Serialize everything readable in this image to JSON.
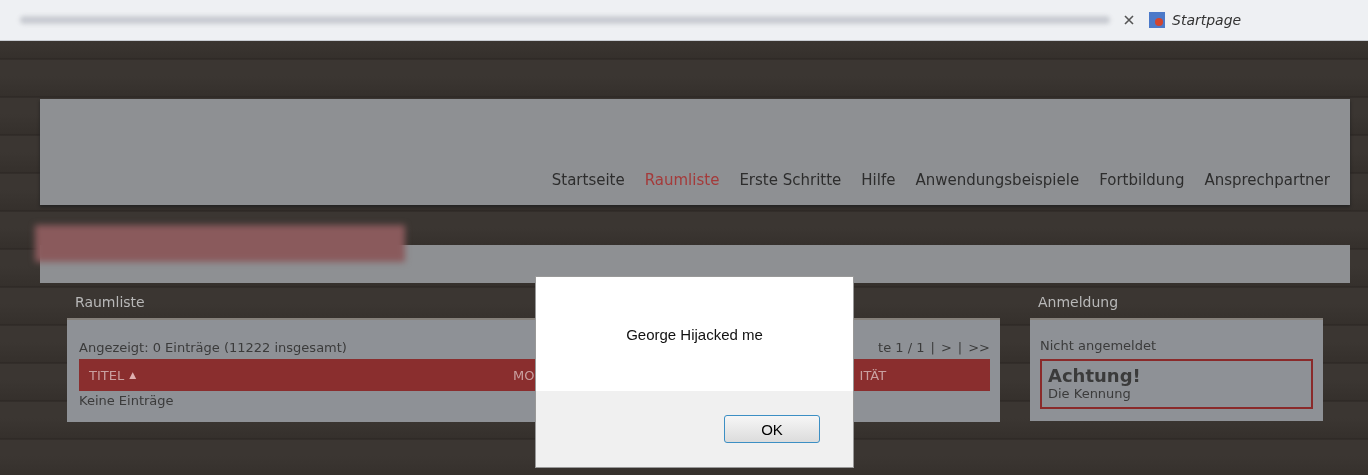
{
  "browser": {
    "tab_title": "Startpage"
  },
  "nav": {
    "items": [
      {
        "label": "Startseite",
        "selected": false
      },
      {
        "label": "Raumliste",
        "selected": true
      },
      {
        "label": "Erste Schritte",
        "selected": false
      },
      {
        "label": "Hilfe",
        "selected": false
      },
      {
        "label": "Anwendungsbeispiele",
        "selected": false
      },
      {
        "label": "Fortbildung",
        "selected": false
      },
      {
        "label": "Ansprechpartner",
        "selected": false
      }
    ]
  },
  "room_list": {
    "title": "Raumliste",
    "summary": "Angezeigt: 0 Einträge (11222 insgesamt)",
    "pagination": [
      "te 1 / 1",
      "|",
      ">",
      "|",
      ">>"
    ],
    "columns": [
      "TITEL",
      "MO",
      "ITÄT"
    ],
    "sort_mark": "▲",
    "empty": "Keine Einträge"
  },
  "login": {
    "title": "Anmeldung",
    "status": "Nicht angemeldet",
    "warning_title": "Achtung!",
    "warning_text": "Die Kennung"
  },
  "dialog": {
    "message": "George Hijacked me",
    "button": "OK"
  }
}
